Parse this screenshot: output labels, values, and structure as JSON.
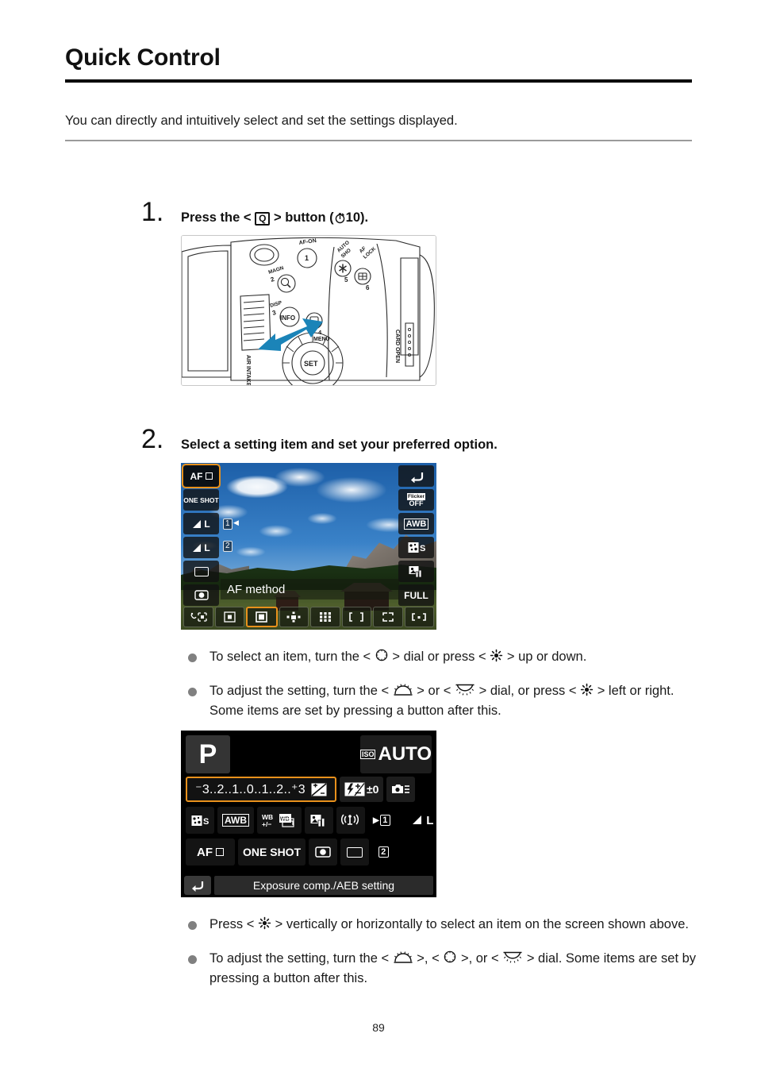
{
  "header": {
    "title": "Quick Control",
    "intro": "You can directly and intuitively select and set the settings displayed."
  },
  "steps": [
    {
      "number": "1.",
      "text_before": "Press the <",
      "button_label": "Q",
      "text_after": "> button (",
      "timer_value": "10",
      "text_end": ")."
    },
    {
      "number": "2.",
      "text": "Select a setting item and set your preferred option."
    }
  ],
  "camera_figure": {
    "labels": {
      "af_on": "AF-ON",
      "num1": "1",
      "auto_sho": "AUTO SHO",
      "af_lock": "AF LOCK",
      "magn": "MAGN",
      "num2": "2",
      "num5": "5",
      "num6": "6",
      "disp": "DISP",
      "num3": "3",
      "info": "INFO",
      "q": "Q",
      "num4": "4",
      "menu": "MENU",
      "air_intake": "AIR INTAKE",
      "set": "SET",
      "card_open": "CARD OPEN"
    },
    "arrow_color": "#1b84b8"
  },
  "quick_control_screen": {
    "left_tiles": [
      {
        "label": "AF",
        "icon": "af-square-icon",
        "selected": true
      },
      {
        "label": "ONE SHOT",
        "icon": "one-shot-icon",
        "selected": false
      },
      {
        "label": "L",
        "icon": "image-quality-large-fine-icon",
        "selected": false
      },
      {
        "label": "L",
        "icon": "image-quality-large-fine-icon",
        "selected": false
      },
      {
        "label": "",
        "icon": "drive-single-icon",
        "selected": false
      },
      {
        "label": "",
        "icon": "metering-evaluative-icon",
        "selected": false
      }
    ],
    "right_tiles": [
      {
        "label": "",
        "icon": "return-arrow-icon",
        "selected": false
      },
      {
        "label": "OFF",
        "icon": "flicker-off-icon",
        "selected": false
      },
      {
        "label": "AWB",
        "icon": "auto-white-balance-icon",
        "selected": false
      },
      {
        "label": "S",
        "icon": "picture-style-standard-icon",
        "selected": false
      },
      {
        "label": "",
        "icon": "image-transfer-icon",
        "selected": false
      },
      {
        "label": "FULL",
        "icon": "full-icon",
        "selected": false
      }
    ],
    "card_badges": [
      "1",
      "2"
    ],
    "setting_name": "AF method",
    "af_method_tiles": [
      {
        "icon": "face-tracking-icon",
        "selected": false
      },
      {
        "icon": "spot-af-icon",
        "selected": false
      },
      {
        "icon": "one-point-af-icon",
        "selected": true
      },
      {
        "icon": "expand-af-cross-icon",
        "selected": false
      },
      {
        "icon": "expand-af-surround-icon",
        "selected": false
      },
      {
        "icon": "zone-af-icon",
        "selected": false
      },
      {
        "icon": "large-zone-vertical-icon",
        "selected": false
      },
      {
        "icon": "large-zone-horizontal-icon",
        "selected": false
      }
    ]
  },
  "bullets_group1": [
    {
      "parts": [
        "To select an item, turn the <",
        "dial-quick-control-icon",
        "> dial or press <",
        "multi-controller-icon",
        "> up or down."
      ]
    },
    {
      "parts": [
        "To adjust the setting, turn the <",
        "main-dial-icon",
        "> or <",
        "sub-dial-icon",
        "> dial, or press <",
        "multi-controller-icon",
        "> left or right. Some items are set by pressing a button after this."
      ]
    }
  ],
  "p_screen": {
    "mode": "P",
    "iso_label": "ISO",
    "iso_value": "AUTO",
    "exposure_scale": "⁻3..2..1..0..1..2..⁺3",
    "exposure_icon": "exposure-compensation-icon",
    "flash_comp": "±0",
    "flash_comp_icon": "flash-exposure-compensation-icon",
    "row1": [
      {
        "label": "S",
        "icon": "picture-style-standard-icon"
      },
      {
        "label": "AWB",
        "icon": "auto-white-balance-icon"
      },
      {
        "label": "WB +/-",
        "icon": "white-balance-correction-icon"
      },
      {
        "label": "WB",
        "icon": "white-balance-bracketing-icon"
      },
      {
        "label": "",
        "icon": "image-transfer-icon"
      },
      {
        "label": "",
        "icon": "wireless-icon"
      },
      {
        "label": "1",
        "icon": "card-slot-1-icon"
      },
      {
        "label": "L",
        "icon": "image-quality-large-fine-icon"
      }
    ],
    "row2": [
      {
        "label": "AF",
        "icon": "af-square-icon"
      },
      {
        "label": "ONE SHOT",
        "icon": "one-shot-icon"
      },
      {
        "label": "",
        "icon": "metering-evaluative-icon"
      },
      {
        "label": "",
        "icon": "drive-single-icon"
      },
      {
        "label": "2",
        "icon": "card-slot-2-icon"
      }
    ],
    "footer_label": "Exposure comp./AEB setting",
    "footer_icon": "return-arrow-icon",
    "highlight_color": "#e8911c"
  },
  "bullets_group2": [
    {
      "parts": [
        "Press <",
        "multi-controller-icon",
        "> vertically or horizontally to select an item on the screen shown above."
      ]
    },
    {
      "parts": [
        "To adjust the setting, turn the <",
        "main-dial-icon",
        ">, <",
        "dial-quick-control-icon",
        ">, or <",
        "sub-dial-icon",
        "> dial. Some items are set by pressing a button after this."
      ]
    }
  ],
  "footer": {
    "page_number": "89"
  }
}
